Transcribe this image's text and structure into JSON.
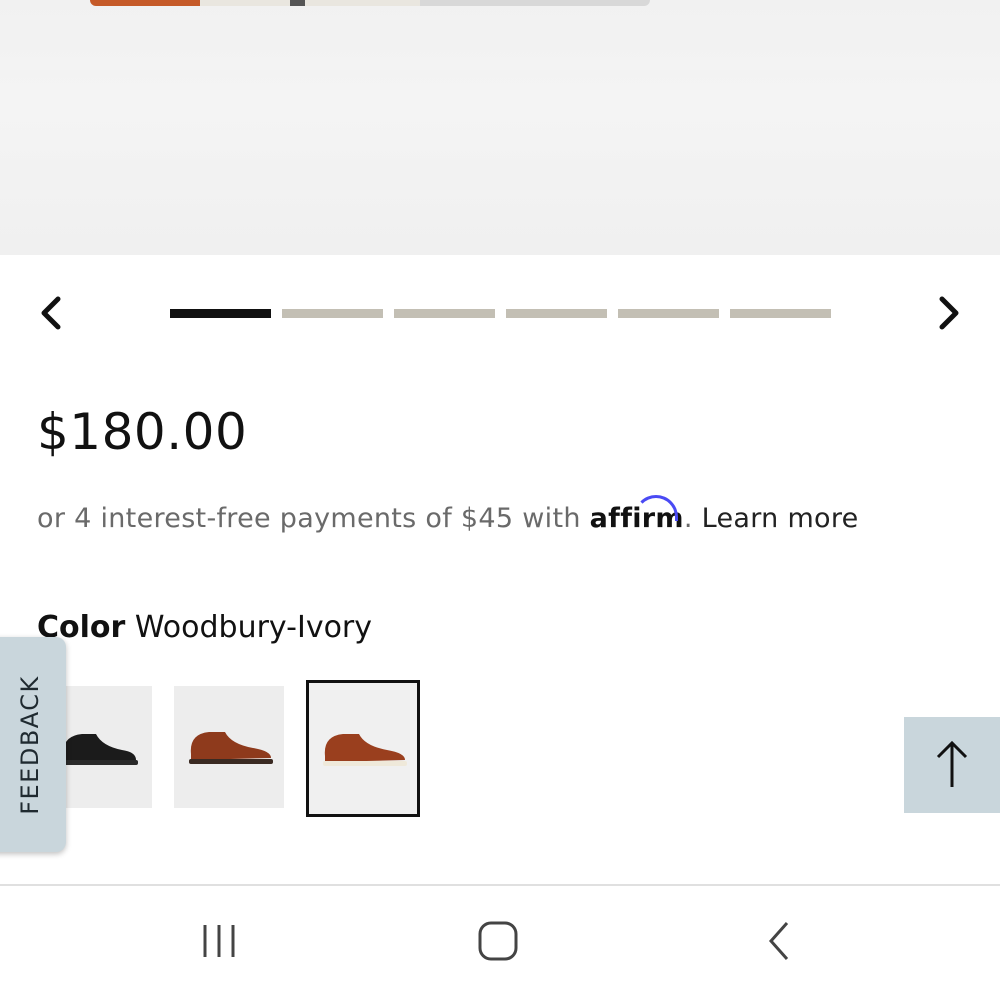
{
  "gallery": {
    "prev_icon": "chevron-left-icon",
    "next_icon": "chevron-right-icon",
    "slide_count": 6,
    "active_index": 0
  },
  "product": {
    "price": "$180.00",
    "affirm": {
      "prefix": "or 4 interest-free payments of $45 with ",
      "logo_text": "affirm",
      "suffix": ". ",
      "learn_more": "Learn more"
    },
    "color": {
      "label": "Color",
      "value": "Woodbury-Ivory"
    },
    "swatches": [
      {
        "name": "black",
        "selected": false
      },
      {
        "name": "brown-dark-sole",
        "selected": false
      },
      {
        "name": "brown-ivory-sole",
        "selected": true
      }
    ]
  },
  "feedback_tab": "FEEDBACK",
  "back_to_top_icon": "arrow-up-icon",
  "system_nav": {
    "recents_icon": "recents-icon",
    "home_icon": "home-icon",
    "back_icon": "back-icon"
  },
  "colors": {
    "accent_blue_gray": "#c9d6dc",
    "indicator_active": "#111111",
    "indicator_inactive": "#c3bfb4",
    "affirm_arc": "#4a4af4"
  }
}
